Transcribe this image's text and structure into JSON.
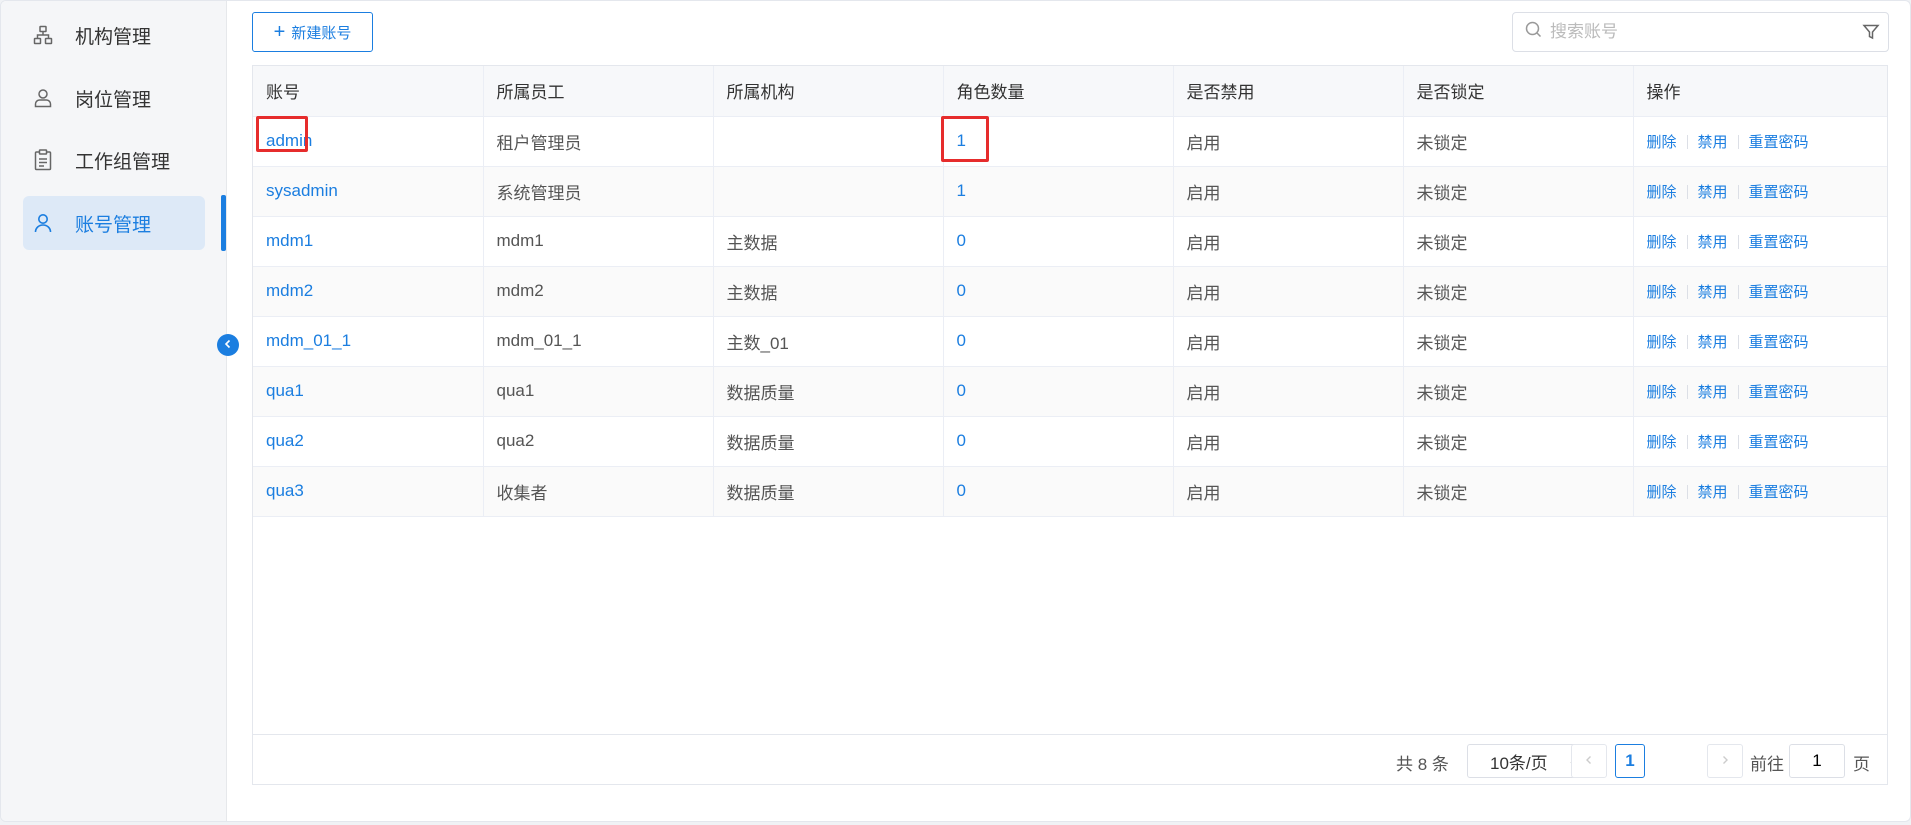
{
  "sidebar": {
    "items": [
      {
        "label": "机构管理",
        "icon": "org-tree-icon"
      },
      {
        "label": "岗位管理",
        "icon": "user-icon"
      },
      {
        "label": "工作组管理",
        "icon": "clipboard-icon"
      },
      {
        "label": "账号管理",
        "icon": "user-icon",
        "active": true
      }
    ]
  },
  "toolbar": {
    "new_label": "新建账号",
    "search_placeholder": "搜索账号"
  },
  "table": {
    "columns": [
      "账号",
      "所属员工",
      "所属机构",
      "角色数量",
      "是否禁用",
      "是否锁定",
      "操作"
    ],
    "rows": [
      {
        "account": "admin",
        "employee": "租户管理员",
        "org": "",
        "roles": "1",
        "disabled": "启用",
        "locked": "未锁定"
      },
      {
        "account": "sysadmin",
        "employee": "系统管理员",
        "org": "",
        "roles": "1",
        "disabled": "启用",
        "locked": "未锁定"
      },
      {
        "account": "mdm1",
        "employee": "mdm1",
        "org": "主数据",
        "roles": "0",
        "disabled": "启用",
        "locked": "未锁定"
      },
      {
        "account": "mdm2",
        "employee": "mdm2",
        "org": "主数据",
        "roles": "0",
        "disabled": "启用",
        "locked": "未锁定"
      },
      {
        "account": "mdm_01_1",
        "employee": "mdm_01_1",
        "org": "主数_01",
        "roles": "0",
        "disabled": "启用",
        "locked": "未锁定"
      },
      {
        "account": "qua1",
        "employee": "qua1",
        "org": "数据质量",
        "roles": "0",
        "disabled": "启用",
        "locked": "未锁定"
      },
      {
        "account": "qua2",
        "employee": "qua2",
        "org": "数据质量",
        "roles": "0",
        "disabled": "启用",
        "locked": "未锁定"
      },
      {
        "account": "qua3",
        "employee": "收集者",
        "org": "数据质量",
        "roles": "0",
        "disabled": "启用",
        "locked": "未锁定"
      }
    ],
    "actions": {
      "delete": "删除",
      "disable": "禁用",
      "reset": "重置密码"
    }
  },
  "pagination": {
    "total_text": "共 8 条",
    "page_size": "10条/页",
    "current_page": "1",
    "goto_prefix": "前往",
    "goto_value": "1",
    "goto_suffix": "页"
  },
  "colors": {
    "accent": "#1b7ee0",
    "highlight": "#e62c2c"
  }
}
